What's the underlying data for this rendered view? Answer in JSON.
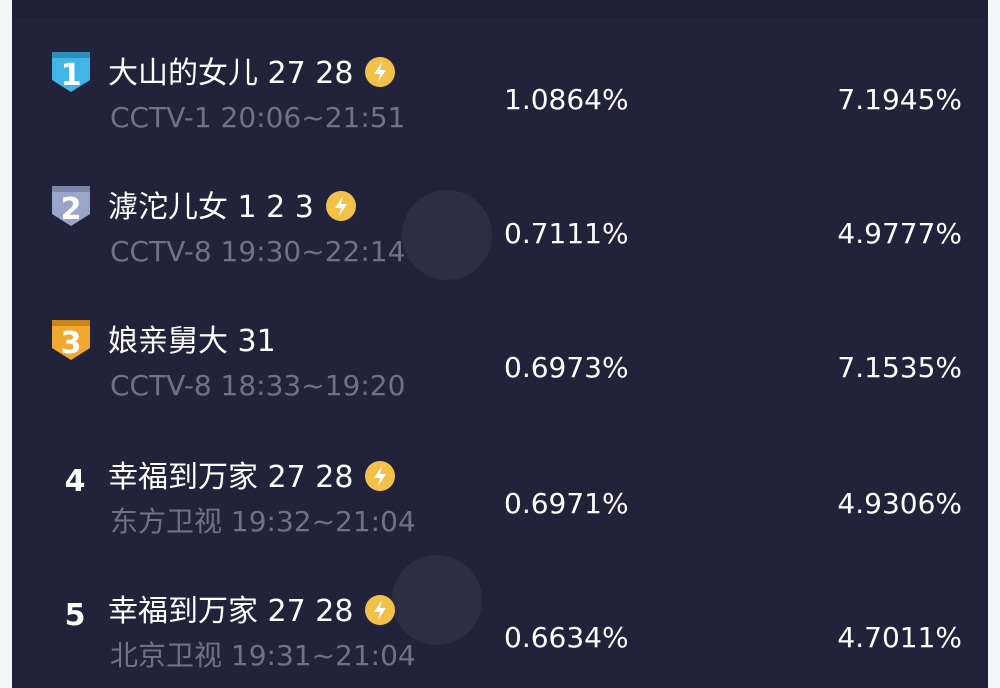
{
  "rows": [
    {
      "rank": "1",
      "title": "大山的女儿 27 28",
      "sub": "CCTV-1 20:06~21:51",
      "pct1": "1.0864%",
      "pct2": "7.1945%",
      "badge": "#41b6e6"
    },
    {
      "rank": "2",
      "title": "滹沱儿女 1 2 3",
      "sub": "CCTV-8 19:30~22:14",
      "pct1": "0.7111%",
      "pct2": "4.9777%",
      "badge": "#9aa6c9"
    },
    {
      "rank": "3",
      "title": "娘亲舅大 31",
      "sub": "CCTV-8 18:33~19:20",
      "pct1": "0.6973%",
      "pct2": "7.1535%",
      "badge": "#f0a830"
    },
    {
      "rank": "4",
      "title": "幸福到万家 27 28",
      "sub": "东方卫视 19:32~21:04",
      "pct1": "0.6971%",
      "pct2": "4.9306%",
      "badge": ""
    },
    {
      "rank": "5",
      "title": "幸福到万家 27 28",
      "sub": "北京卫视 19:31~21:04",
      "pct1": "0.6634%",
      "pct2": "4.7011%",
      "badge": ""
    }
  ],
  "colors": {
    "background": "#22233a",
    "accent_bolt": "#f2c14a",
    "subtext": "#6f7186"
  },
  "icons": {
    "badge": "rank-ribbon-icon",
    "bolt": "lightning-icon"
  }
}
